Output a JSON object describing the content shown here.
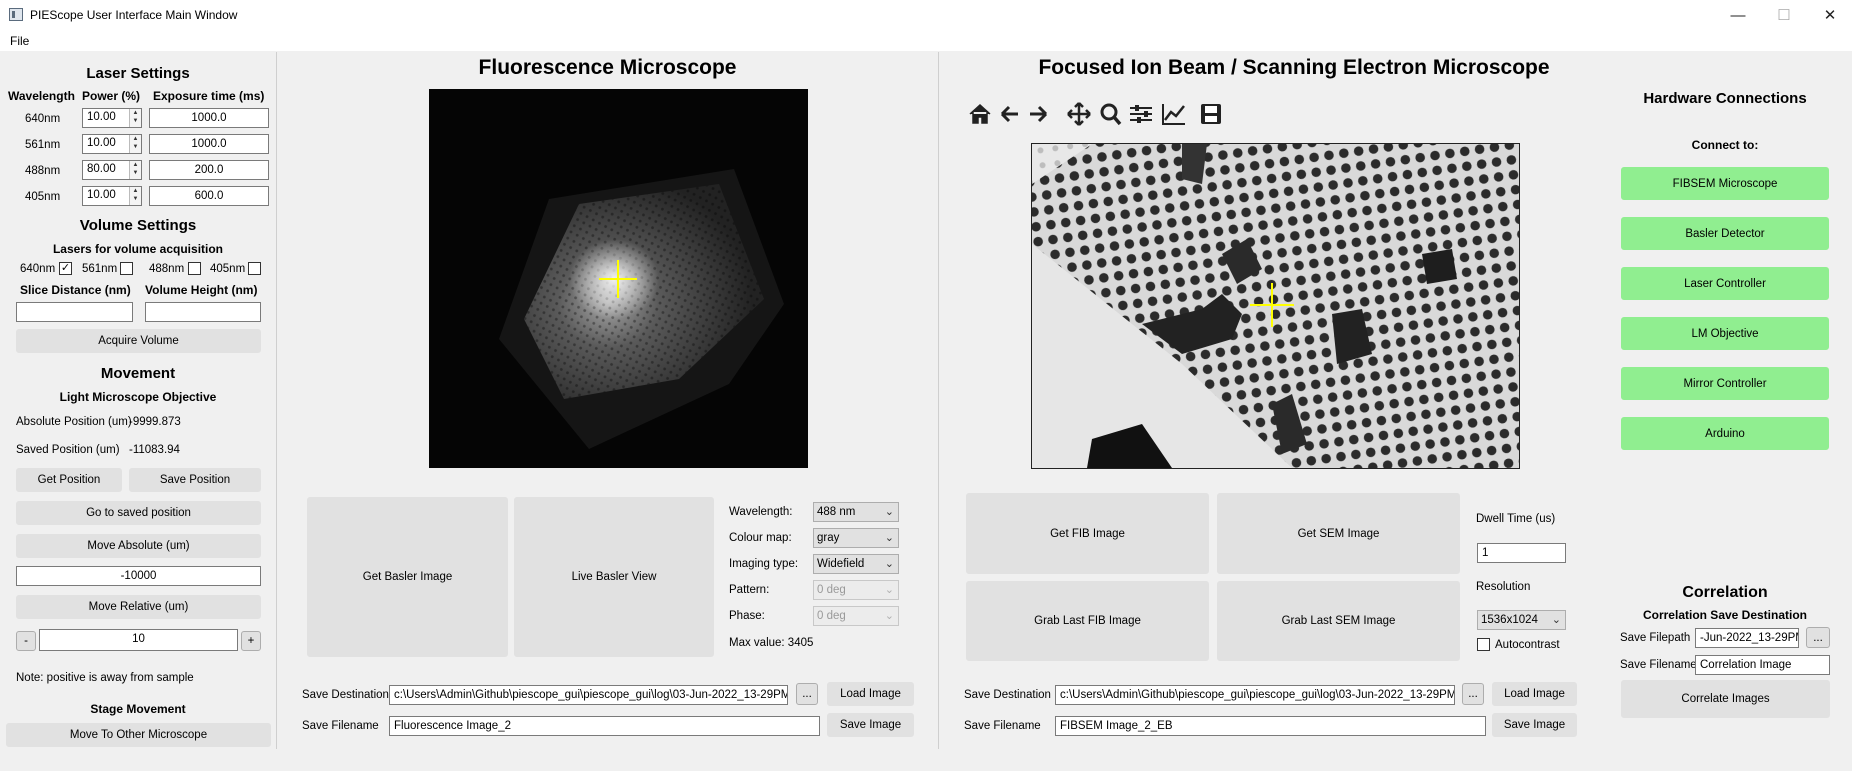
{
  "window": {
    "title": "PIEScope User Interface Main Window",
    "minimize": "—",
    "maximize": "☐",
    "close": "✕"
  },
  "menu": {
    "file": "File"
  },
  "laser": {
    "title": "Laser Settings",
    "headers": {
      "wavelength": "Wavelength",
      "power": "Power (%)",
      "exposure": "Exposure time (ms)"
    },
    "rows": [
      {
        "wavelength": "640nm",
        "power": "10.00",
        "exposure": "1000.0"
      },
      {
        "wavelength": "561nm",
        "power": "10.00",
        "exposure": "1000.0"
      },
      {
        "wavelength": "488nm",
        "power": "80.00",
        "exposure": "200.0"
      },
      {
        "wavelength": "405nm",
        "power": "10.00",
        "exposure": "600.0"
      }
    ]
  },
  "volume": {
    "title": "Volume Settings",
    "lasers_label": "Lasers for volume acquisition",
    "checks": [
      {
        "label": "640nm",
        "checked": "✓"
      },
      {
        "label": "561nm",
        "checked": ""
      },
      {
        "label": "488nm",
        "checked": ""
      },
      {
        "label": "405nm",
        "checked": ""
      }
    ],
    "slice_label": "Slice Distance (nm)",
    "height_label": "Volume Height (nm)",
    "slice_value": "",
    "height_value": "",
    "acquire": "Acquire Volume"
  },
  "movement": {
    "title": "Movement",
    "objective_title": "Light Microscope Objective",
    "absolute_label": "Absolute Position (um)",
    "absolute_value": "-9999.873",
    "saved_label": "Saved Position (um)",
    "saved_value": "-11083.94",
    "get_position": "Get Position",
    "save_position": "Save Position",
    "goto_saved": "Go to saved position",
    "move_absolute": "Move Absolute (um)",
    "absolute_input": "-10000",
    "move_relative": "Move Relative (um)",
    "minus": "-",
    "relative_input": "10",
    "plus": "+",
    "note": "Note: positive is away from sample",
    "stage_title": "Stage Movement",
    "move_other": "Move To Other Microscope"
  },
  "fluorescence": {
    "title": "Fluorescence Microscope",
    "get_basler": "Get Basler Image",
    "live_basler": "Live Basler View",
    "wavelength_label": "Wavelength:",
    "wavelength_value": "488 nm",
    "colour_label": "Colour map:",
    "colour_value": "gray",
    "imaging_label": "Imaging type:",
    "imaging_value": "Widefield",
    "pattern_label": "Pattern:",
    "pattern_value": "0 deg",
    "phase_label": "Phase:",
    "phase_value": "0 deg",
    "max_value": "Max value: 3405",
    "save_dest_label": "Save Destination",
    "save_dest_value": "c:\\Users\\Admin\\Github\\piescope_gui\\piescope_gui\\log\\03-Jun-2022_13-29PM",
    "browse": "...",
    "load_image": "Load Image",
    "save_filename_label": "Save Filename",
    "save_filename_value": "Fluorescence Image_2",
    "save_image": "Save Image"
  },
  "fibsem": {
    "title": "Focused Ion Beam / Scanning Electron Microscope",
    "get_fib": "Get FIB Image",
    "get_sem": "Get SEM Image",
    "grab_fib": "Grab Last FIB Image",
    "grab_sem": "Grab Last SEM Image",
    "dwell_label": "Dwell Time (us)",
    "dwell_value": "1",
    "resolution_label": "Resolution",
    "resolution_value": "1536x1024",
    "autocontrast_label": "Autocontrast",
    "autocontrast_checked": "",
    "save_dest_label": "Save Destination",
    "save_dest_value": "c:\\Users\\Admin\\Github\\piescope_gui\\piescope_gui\\log\\03-Jun-2022_13-29PM",
    "browse": "...",
    "load_image": "Load Image",
    "save_filename_label": "Save Filename",
    "save_filename_value": "FIBSEM Image_2_EB",
    "save_image": "Save Image"
  },
  "toolbar": {
    "icons": [
      "home-icon",
      "back-arrow-icon",
      "forward-arrow-icon",
      "pan-icon",
      "zoom-icon",
      "configure-subplots-icon",
      "edit-axis-icon",
      "save-figure-icon"
    ]
  },
  "hardware": {
    "title": "Hardware Connections",
    "connect_to": "Connect to:",
    "buttons": [
      "FIBSEM Microscope",
      "Basler Detector",
      "Laser Controller",
      "LM Objective",
      "Mirror Controller",
      "Arduino"
    ],
    "button_color": "#90ee90"
  },
  "correlation": {
    "title": "Correlation",
    "dest_title": "Correlation Save Destination",
    "filepath_label": "Save Filepath",
    "filepath_value": "-Jun-2022_13-29PM",
    "browse": "...",
    "filename_label": "Save Filename",
    "filename_value": "Correlation Image",
    "correlate": "Correlate Images"
  },
  "colors": {
    "crosshair": "#ffff00",
    "window_bg": "#f0f0f0",
    "button_bg": "#e1e1e1"
  }
}
